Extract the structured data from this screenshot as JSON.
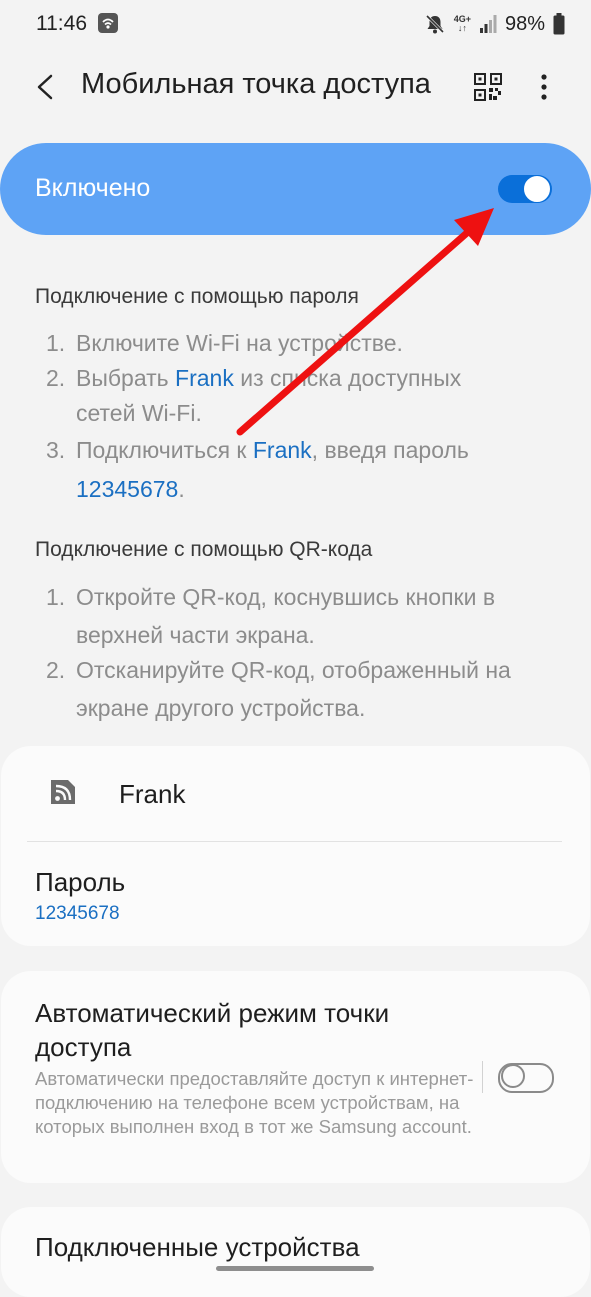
{
  "status_bar": {
    "time": "11:46",
    "network_type": "4G+",
    "battery": "98%"
  },
  "app_bar": {
    "title": "Мобильная точка доступа"
  },
  "master_switch": {
    "label": "Включено",
    "state": "on",
    "accent_color": "#5ea3f5"
  },
  "password_section": {
    "heading": "Подключение с помощью пароля",
    "steps": [
      {
        "num": "1.",
        "text": "Включите Wi-Fi на устройстве."
      },
      {
        "num": "2.",
        "pre": "Выбрать ",
        "link": "Frank",
        "post": " из списка доступных",
        "line2": "сетей Wi-Fi."
      },
      {
        "num": "3.",
        "pre": "Подключиться к ",
        "link": "Frank",
        "post": ", введя пароль",
        "line2_link": "12345678",
        "line2_post": "."
      }
    ]
  },
  "qr_section": {
    "heading": "Подключение с помощью QR-кода",
    "steps": [
      {
        "num": "1.",
        "line1": "Откройте QR-код, коснувшись кнопки в",
        "line2": "верхней части экрана."
      },
      {
        "num": "2.",
        "line1": "Отсканируйте QR-код, отображенный на",
        "line2": "экране другого устройства."
      }
    ]
  },
  "network_card": {
    "ssid": "Frank",
    "password_label": "Пароль",
    "password_value": "12345678"
  },
  "auto_hotspot": {
    "title": "Автоматический режим точки доступа",
    "description": "Автоматически предоставляйте доступ к интернет-подключению на телефоне всем устройствам, на которых выполнен вход в тот же Samsung account.",
    "state": "off"
  },
  "connected_devices": {
    "title": "Подключенные устройства"
  },
  "annotation": {
    "arrow_color": "#ee1111"
  }
}
